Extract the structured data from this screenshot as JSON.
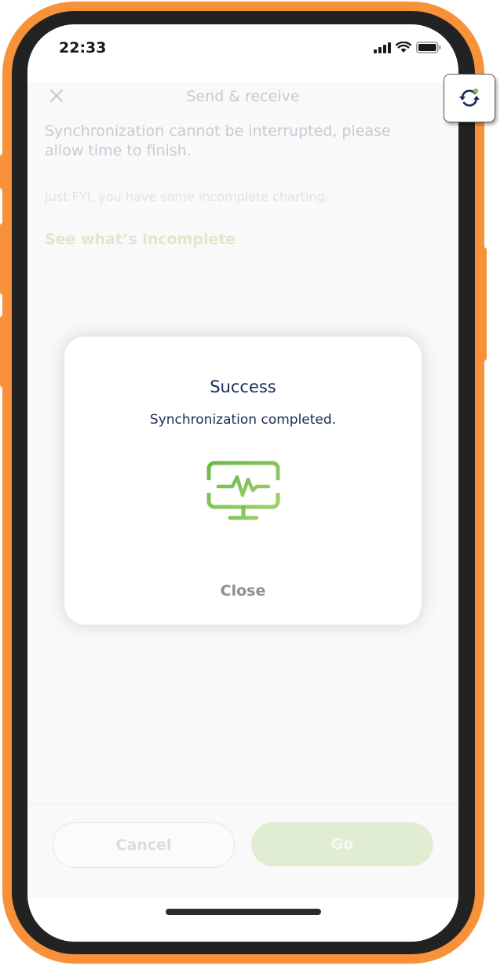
{
  "status_bar": {
    "time": "22:33",
    "icons": [
      "signal-icon",
      "wifi-icon",
      "battery-icon"
    ]
  },
  "header": {
    "title": "Send & receive",
    "close_icon": "close-icon"
  },
  "content": {
    "sync_message": "Synchronization cannot be interrupted, please allow time to finish.",
    "fyi_message": "Just FYI, you have some incomplete charting.",
    "incomplete_link": "See what’s incomplete"
  },
  "footer": {
    "cancel_label": "Cancel",
    "go_label": "Go"
  },
  "modal": {
    "title": "Success",
    "message": "Synchronization completed.",
    "icon": "monitor-heartbeat-icon",
    "close_label": "Close"
  },
  "floating": {
    "icon": "sync-icon"
  },
  "colors": {
    "frame": "#f7923a",
    "brand_navy": "#1b2a57",
    "brand_green": "#7ac25a",
    "muted_text": "#c8cbd6"
  }
}
